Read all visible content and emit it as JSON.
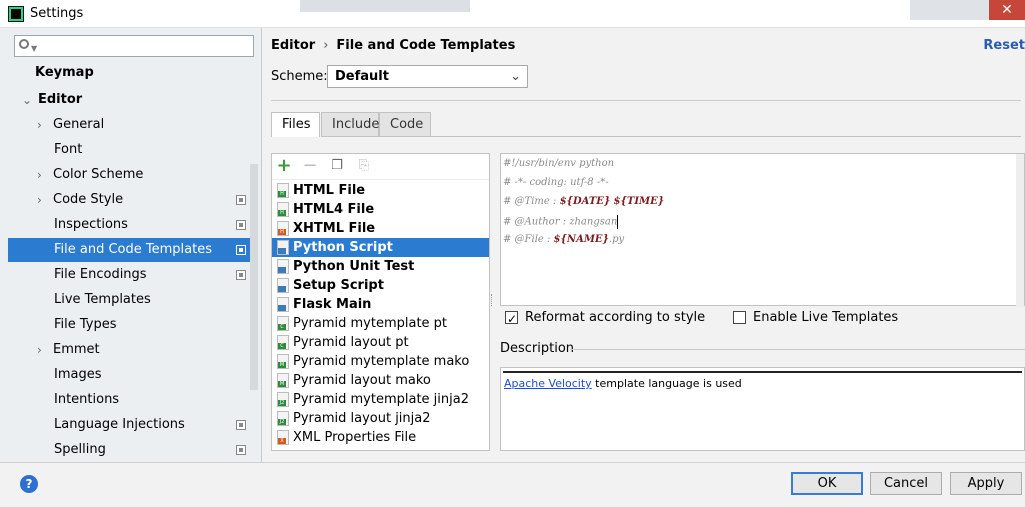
{
  "window": {
    "title": "Settings"
  },
  "search": {
    "placeholder": ""
  },
  "sidebar": {
    "items": [
      {
        "label": "Keymap"
      },
      {
        "label": "Editor"
      },
      {
        "label": "General"
      },
      {
        "label": "Font"
      },
      {
        "label": "Color Scheme"
      },
      {
        "label": "Code Style"
      },
      {
        "label": "Inspections"
      },
      {
        "label": "File and Code Templates"
      },
      {
        "label": "File Encodings"
      },
      {
        "label": "Live Templates"
      },
      {
        "label": "File Types"
      },
      {
        "label": "Emmet"
      },
      {
        "label": "Images"
      },
      {
        "label": "Intentions"
      },
      {
        "label": "Language Injections"
      },
      {
        "label": "Spelling"
      }
    ]
  },
  "breadcrumb": {
    "parent": "Editor",
    "sep": "›",
    "current": "File and Code Templates"
  },
  "reset_label": "Reset",
  "scheme": {
    "label": "Scheme:",
    "value": "Default"
  },
  "tabs": [
    {
      "label": "Files"
    },
    {
      "label": "Includes"
    },
    {
      "label": "Code"
    }
  ],
  "files": [
    {
      "name": "HTML File",
      "badge": "H",
      "badge_color": "#2e8b3c"
    },
    {
      "name": "HTML4 File",
      "badge": "H",
      "badge_color": "#2e8b3c"
    },
    {
      "name": "XHTML File",
      "badge": "H",
      "badge_color": "#d35a21"
    },
    {
      "name": "Python Script",
      "badge": "",
      "badge_color": "#3d7ab8"
    },
    {
      "name": "Python Unit Test",
      "badge": "",
      "badge_color": "#3d7ab8"
    },
    {
      "name": "Setup Script",
      "badge": "",
      "badge_color": "#3d7ab8"
    },
    {
      "name": "Flask Main",
      "badge": "",
      "badge_color": "#3d7ab8"
    },
    {
      "name": "Pyramid mytemplate pt",
      "badge": "C",
      "badge_color": "#2e8b3c"
    },
    {
      "name": "Pyramid layout pt",
      "badge": "C",
      "badge_color": "#2e8b3c"
    },
    {
      "name": "Pyramid mytemplate mako",
      "badge": "M",
      "badge_color": "#2e8b3c"
    },
    {
      "name": "Pyramid layout mako",
      "badge": "M",
      "badge_color": "#2e8b3c"
    },
    {
      "name": "Pyramid mytemplate jinja2",
      "badge": "J2",
      "badge_color": "#2e8b3c"
    },
    {
      "name": "Pyramid layout jinja2",
      "badge": "J2",
      "badge_color": "#2e8b3c"
    },
    {
      "name": "XML Properties File",
      "badge": "X",
      "badge_color": "#d35a21"
    }
  ],
  "editor": {
    "lines": [
      {
        "pre": "#!/usr/bin/env python",
        "var1": "",
        "mid": "",
        "var2": "",
        "post": ""
      },
      {
        "pre": "# -*- coding: utf-8 -*-",
        "var1": "",
        "mid": "",
        "var2": "",
        "post": ""
      },
      {
        "pre": "# @Time : ",
        "var1": "${DATE}",
        "mid": " ",
        "var2": "${TIME}",
        "post": ""
      },
      {
        "pre": "# @Author : zhangsan",
        "var1": "",
        "mid": "",
        "var2": "",
        "post": ""
      },
      {
        "pre": "# @File : ",
        "var1": "${NAME}",
        "mid": "",
        "var2": "",
        "post": ".py"
      }
    ]
  },
  "reformat": {
    "label": "Reformat according to style",
    "checked": true
  },
  "live_templates": {
    "label": "Enable Live Templates",
    "checked": false
  },
  "description": {
    "label": "Description",
    "link": "Apache Velocity",
    "text": " template language is used"
  },
  "footer": {
    "help": "?",
    "ok": "OK",
    "cancel": "Cancel",
    "apply": "Apply"
  },
  "colors": {
    "selection": "#2b7bd0",
    "link": "#1a4dcf",
    "variable": "#7b1d1d"
  }
}
